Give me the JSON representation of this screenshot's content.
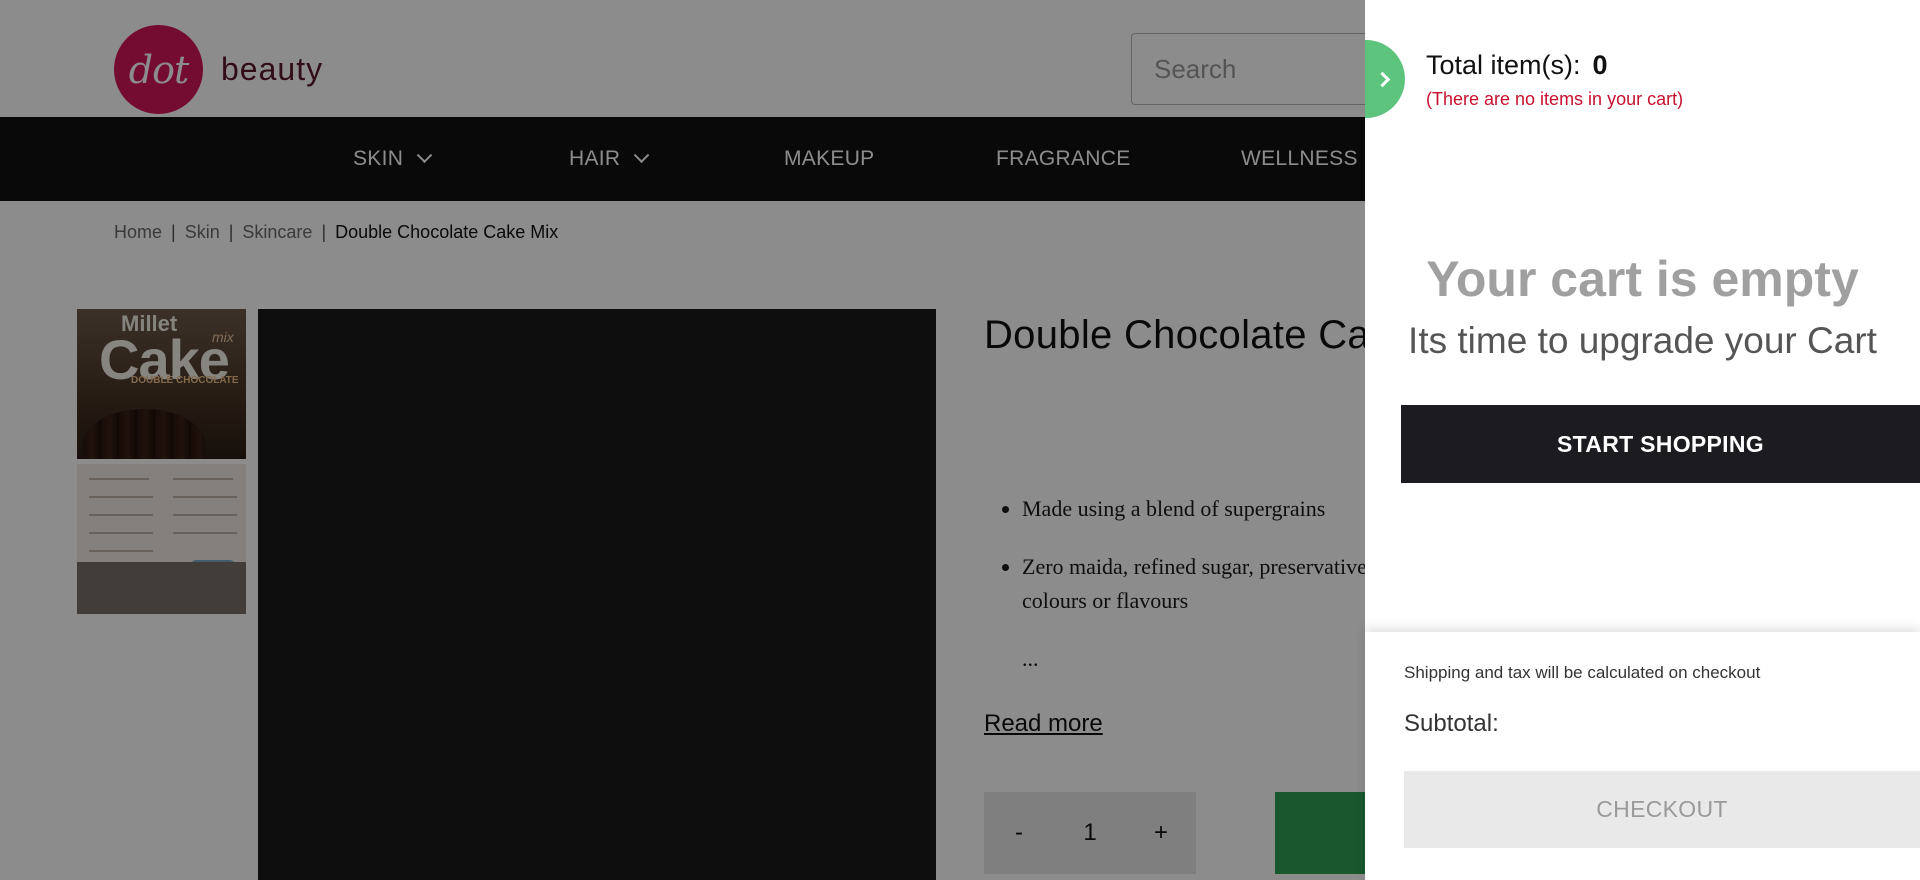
{
  "brand": {
    "logo_mark": "dot",
    "logo_text": "beauty",
    "accent": "#d4145a"
  },
  "search": {
    "placeholder": "Search"
  },
  "nav": {
    "items": [
      {
        "label": "SKIN",
        "has_dropdown": true
      },
      {
        "label": "HAIR",
        "has_dropdown": true
      },
      {
        "label": "MAKEUP",
        "has_dropdown": false
      },
      {
        "label": "FRAGRANCE",
        "has_dropdown": false
      },
      {
        "label": "WELLNESS",
        "has_dropdown": false
      }
    ]
  },
  "breadcrumb": {
    "items": [
      "Home",
      "Skin",
      "Skincare"
    ],
    "current": "Double Chocolate Cake Mix"
  },
  "gallery": {
    "thumb1": {
      "line1": "Millet",
      "line2": "Cake",
      "tag": "mix",
      "line3": "DOUBLE CHOCOLATE"
    }
  },
  "product": {
    "title": "Double Chocolate Cake Mix",
    "bullets": [
      "Made using a blend of supergrains",
      "Zero maida, refined sugar, preservatives,",
      "colours or flavours"
    ],
    "ellipsis": "...",
    "read_more": "Read more",
    "quantity": {
      "minus": "-",
      "value": "1",
      "plus": "+"
    }
  },
  "cart": {
    "total_label": "Total item(s):",
    "total_count": "0",
    "empty_note": "(There are no items in your cart)",
    "empty_title": "Your cart is empty",
    "empty_sub": "Its time to upgrade your Cart",
    "start_shopping": "START SHOPPING",
    "shipping_note": "Shipping and tax will be calculated on checkout",
    "subtotal_label": "Subtotal:",
    "checkout": "CHECKOUT",
    "close_color": "#5cc47c",
    "note_color": "#c8102e"
  }
}
